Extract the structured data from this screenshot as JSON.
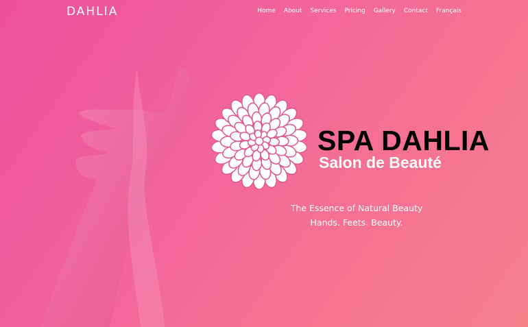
{
  "header": {
    "brand": "DAHLIA",
    "nav": [
      {
        "label": "Home"
      },
      {
        "label": "About"
      },
      {
        "label": "Services"
      },
      {
        "label": "Pricing"
      },
      {
        "label": "Gallery"
      },
      {
        "label": "Contact"
      },
      {
        "label": "Français"
      }
    ]
  },
  "hero": {
    "logo_icon": "dahlia-flower-icon",
    "title": "SPA DAHLIA",
    "subtitle": "Salon de Beauté",
    "tagline_1": "The Essence of Natural Beauty",
    "tagline_2": "Hands. Feets. Beauty."
  },
  "colors": {
    "background_start": "#ee4f9d",
    "background_end": "#f7808a",
    "title": "#000000",
    "text": "#ffffff"
  }
}
